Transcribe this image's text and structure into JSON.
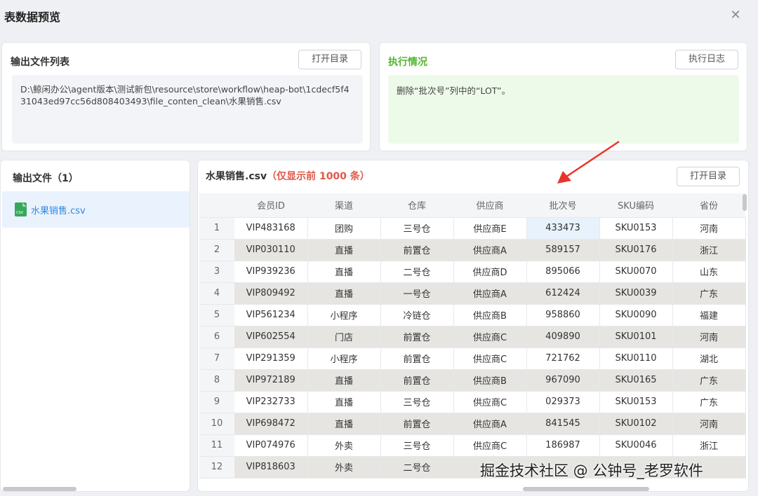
{
  "window": {
    "title": "表数据预览",
    "close_glyph": "✕"
  },
  "output_files_panel": {
    "title": "输出文件列表",
    "open_dir_label": "打开目录",
    "path": "D:\\鲸闲办公\\agent版本\\测试新包\\resource\\store\\workflow\\heap-bot\\1cdecf5f431043ed97cc56d808403493\\file_conten_clean\\水果销售.csv"
  },
  "execution_panel": {
    "title": "执行情况",
    "log_button_label": "执行日志",
    "message": "删除“批次号”列中的“LOT”。",
    "title_color": "#52b72f"
  },
  "file_list_panel": {
    "title": "输出文件（1）",
    "files": [
      {
        "name": "水果销售.csv",
        "icon": "csv-file-icon"
      }
    ]
  },
  "preview_panel": {
    "filename": "水果销售.csv",
    "hint": "（仅显示前 1000 条）",
    "open_dir_label": "打开目录"
  },
  "table": {
    "columns": [
      "",
      "会员ID",
      "渠道",
      "仓库",
      "供应商",
      "批次号",
      "SKU编码",
      "省份"
    ],
    "rows": [
      [
        "1",
        "VIP483168",
        "团购",
        "三号仓",
        "供应商E",
        "433473",
        "SKU0153",
        "河南"
      ],
      [
        "2",
        "VIP030110",
        "直播",
        "前置仓",
        "供应商A",
        "589157",
        "SKU0176",
        "浙江"
      ],
      [
        "3",
        "VIP939236",
        "直播",
        "二号仓",
        "供应商D",
        "895066",
        "SKU0070",
        "山东"
      ],
      [
        "4",
        "VIP809492",
        "直播",
        "一号仓",
        "供应商A",
        "612424",
        "SKU0039",
        "广东"
      ],
      [
        "5",
        "VIP561234",
        "小程序",
        "冷链仓",
        "供应商B",
        "958860",
        "SKU0090",
        "福建"
      ],
      [
        "6",
        "VIP602554",
        "门店",
        "前置仓",
        "供应商C",
        "409890",
        "SKU0101",
        "河南"
      ],
      [
        "7",
        "VIP291359",
        "小程序",
        "前置仓",
        "供应商C",
        "721762",
        "SKU0110",
        "湖北"
      ],
      [
        "8",
        "VIP972189",
        "直播",
        "前置仓",
        "供应商B",
        "967090",
        "SKU0165",
        "广东"
      ],
      [
        "9",
        "VIP232733",
        "直播",
        "三号仓",
        "供应商C",
        "029373",
        "SKU0153",
        "广东"
      ],
      [
        "10",
        "VIP698472",
        "直播",
        "前置仓",
        "供应商A",
        "841545",
        "SKU0102",
        "河南"
      ],
      [
        "11",
        "VIP074976",
        "外卖",
        "三号仓",
        "供应商C",
        "186987",
        "SKU0046",
        "浙江"
      ],
      [
        "12",
        "VIP818603",
        "外卖",
        "二号仓",
        "",
        "",
        "",
        ""
      ]
    ]
  },
  "watermark": "掘金技术社区 @ 公钟号_老罗软件",
  "annotation": {
    "icon": "red-arrow-icon",
    "color": "#e8352b"
  }
}
